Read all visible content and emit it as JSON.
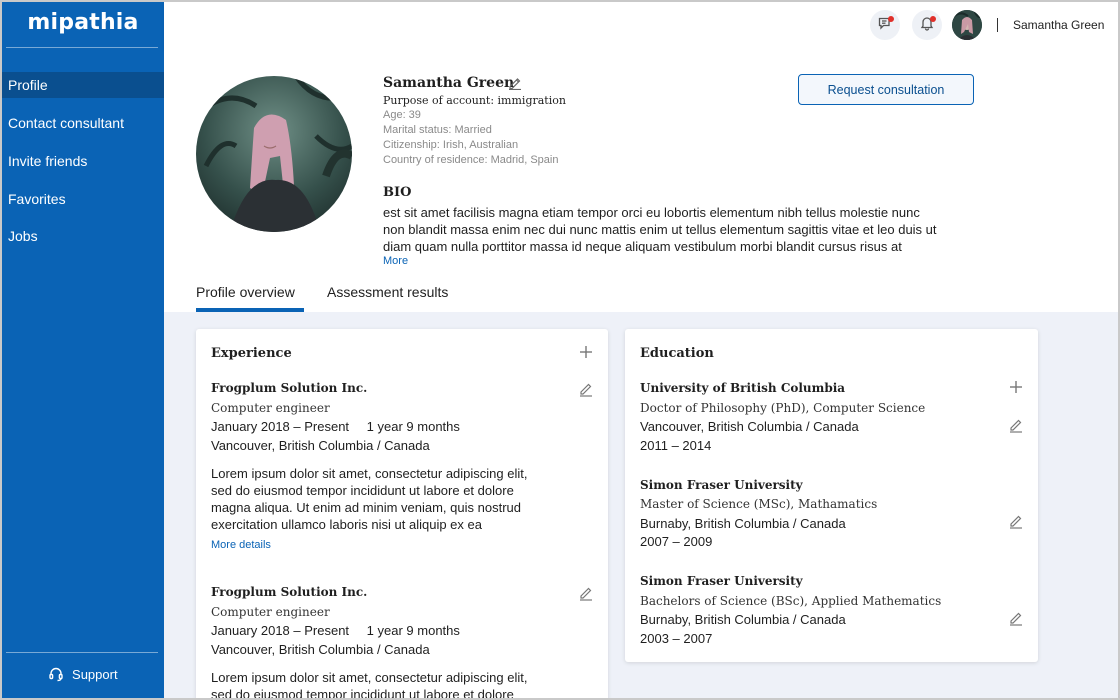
{
  "app": {
    "logo": "mipathia"
  },
  "sidebar": {
    "items": [
      {
        "label": "Profile",
        "active": true
      },
      {
        "label": "Contact consultant",
        "active": false
      },
      {
        "label": "Invite friends",
        "active": false
      },
      {
        "label": "Favorites",
        "active": false
      },
      {
        "label": "Jobs",
        "active": false
      }
    ],
    "support_label": "Support"
  },
  "topbar": {
    "icons": [
      "chat-icon",
      "bell-icon"
    ],
    "username": "Samantha Green"
  },
  "profile": {
    "name": "Samantha Green",
    "purpose": "Purpose of account: immigration",
    "age": "Age: 39",
    "marital_status": "Marital status: Married",
    "citizenship": "Citizenship: Irish, Australian",
    "country": "Country of residence: Madrid, Spain",
    "request_button": "Request consultation",
    "bio_title": "BIO",
    "bio_line1": "est sit amet facilisis magna etiam tempor orci eu lobortis elementum nibh tellus molestie nunc",
    "bio_line2": "non blandit massa enim nec dui nunc mattis enim ut tellus elementum sagittis vitae et leo duis ut",
    "bio_line3": "diam quam nulla porttitor massa id neque aliquam vestibulum morbi blandit cursus risus at",
    "bio_more": "More"
  },
  "tabs": [
    {
      "label": "Profile overview",
      "active": true
    },
    {
      "label": "Assessment results",
      "active": false
    }
  ],
  "experience": {
    "title": "Experience",
    "entries": [
      {
        "company": "Frogplum Solution Inc.",
        "role": "Computer engineer",
        "dates": "January 2018 – Present",
        "duration": "1 year 9 months",
        "location": "Vancouver, British Columbia / Canada",
        "desc1": "Lorem ipsum dolor sit amet, consectetur adipiscing elit,",
        "desc2": "sed do eiusmod tempor incididunt ut labore et dolore",
        "desc3": "magna aliqua. Ut enim ad minim veniam, quis nostrud",
        "desc4": "exercitation ullamco laboris nisi ut aliquip ex ea",
        "more": "More details"
      },
      {
        "company": "Frogplum Solution Inc.",
        "role": "Computer engineer",
        "dates": "January 2018 – Present",
        "duration": "1 year 9 months",
        "location": "Vancouver, British Columbia / Canada",
        "desc1": "Lorem ipsum dolor sit amet, consectetur adipiscing elit,",
        "desc2": "sed do eiusmod tempor incididunt ut labore et dolore"
      }
    ]
  },
  "education": {
    "title": "Education",
    "entries": [
      {
        "school": "University of British Columbia",
        "degree": "Doctor of Philosophy (PhD), Computer Science",
        "location": "Vancouver, British Columbia / Canada",
        "years": "2011 – 2014"
      },
      {
        "school": "Simon Fraser University",
        "degree": "Master of Science (MSc), Mathamatics",
        "location": "Burnaby, British Columbia / Canada",
        "years": "2007 – 2009"
      },
      {
        "school": "Simon Fraser University",
        "degree": "Bachelors of Science (BSc), Applied Mathematics",
        "location": "Burnaby, British Columbia / Canada",
        "years": "2003 – 2007"
      }
    ]
  },
  "colors": {
    "brand": "#0a63b5",
    "brand_dark": "#0a4f8f",
    "content_bg": "#eef1f8",
    "notification": "#e0302a"
  }
}
